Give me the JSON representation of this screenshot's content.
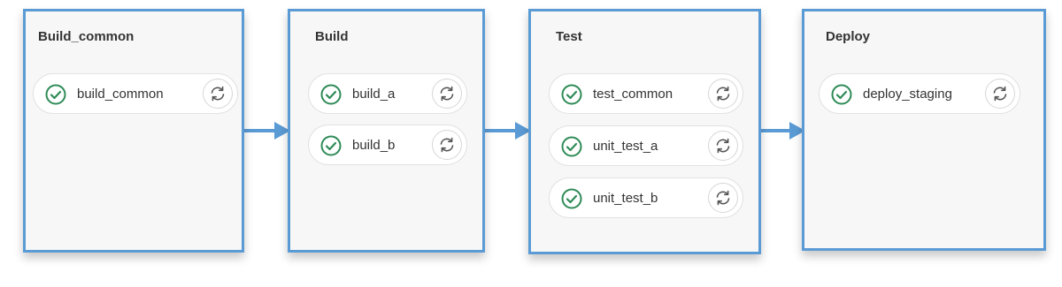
{
  "colors": {
    "stage_border": "#5b9bd5",
    "stage_background": "#f7f7f7",
    "success": "#2e8b57",
    "connector": "#5b9bd5"
  },
  "stages": [
    {
      "title": "Build_common",
      "jobs": [
        {
          "name": "build_common",
          "status_icon": "check-circle-icon",
          "action_icon": "retry-icon"
        }
      ]
    },
    {
      "title": "Build",
      "jobs": [
        {
          "name": "build_a",
          "status_icon": "check-circle-icon",
          "action_icon": "retry-icon"
        },
        {
          "name": "build_b",
          "status_icon": "check-circle-icon",
          "action_icon": "retry-icon"
        }
      ]
    },
    {
      "title": "Test",
      "jobs": [
        {
          "name": "test_common",
          "status_icon": "check-circle-icon",
          "action_icon": "retry-icon"
        },
        {
          "name": "unit_test_a",
          "status_icon": "check-circle-icon",
          "action_icon": "retry-icon"
        },
        {
          "name": "unit_test_b",
          "status_icon": "check-circle-icon",
          "action_icon": "retry-icon"
        }
      ]
    },
    {
      "title": "Deploy",
      "jobs": [
        {
          "name": "deploy_staging",
          "status_icon": "check-circle-icon",
          "action_icon": "retry-icon"
        }
      ]
    }
  ]
}
